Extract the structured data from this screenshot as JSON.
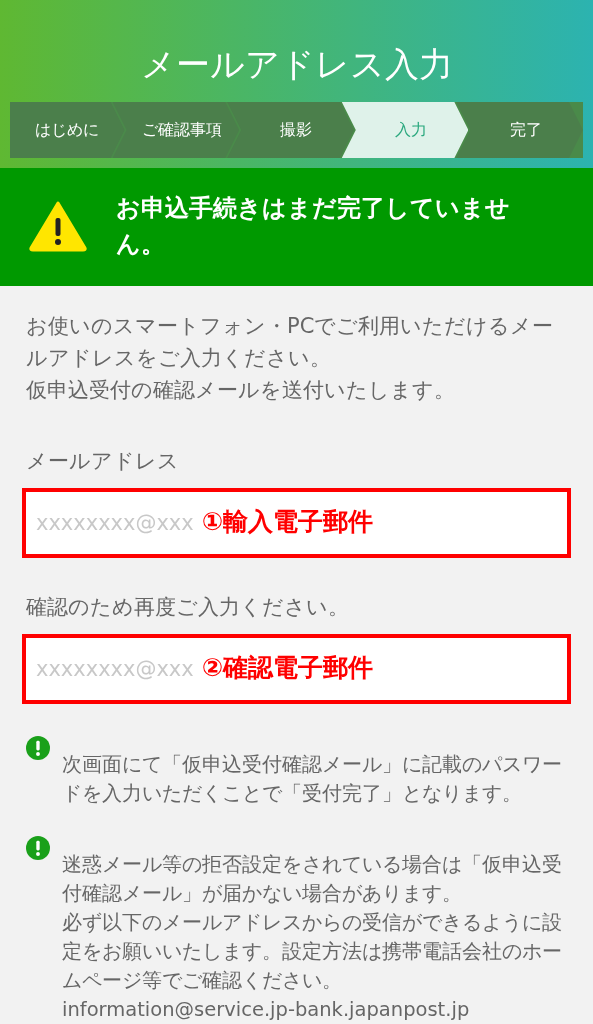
{
  "header": {
    "title": "メールアドレス入力"
  },
  "steps": [
    {
      "label": "はじめに",
      "selected": false
    },
    {
      "label": "ご確認事項",
      "selected": false
    },
    {
      "label": "撮影",
      "selected": false
    },
    {
      "label": "入力",
      "selected": true
    },
    {
      "label": "完了",
      "selected": false
    }
  ],
  "warning_banner": {
    "text": "お申込手続きはまだ完了していません。"
  },
  "intro": [
    "お使いのスマートフォン・PCでご利用いただけるメールアドレスをご入力ください。",
    "仮申込受付の確認メールを送付いたします。"
  ],
  "fields": [
    {
      "label": "メールアドレス",
      "placeholder": "xxxxxxxx@xxx",
      "annotation": "①輸入電子郵件"
    },
    {
      "label": "確認のため再度ご入力ください。",
      "placeholder": "xxxxxxxx@xxx",
      "annotation": "②確認電子郵件"
    }
  ],
  "notes": [
    {
      "paragraphs": [
        "次画面にて「仮申込受付確認メール」に記載のパスワードを入力いただくことで「受付完了」となります。"
      ]
    },
    {
      "paragraphs": [
        "迷惑メール等の拒否設定をされている場合は「仮申込受付確認メール」が届かない場合があります。",
        "必ず以下のメールアドレスからの受信ができるように設定をお願いいたします。設定方法は携帯電話会社のホームページ等でご確認ください。",
        "information@service.jp-bank.japanpost.jp"
      ]
    }
  ]
}
